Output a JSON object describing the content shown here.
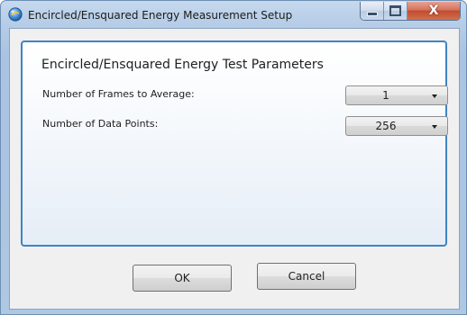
{
  "window": {
    "title": "Encircled/Ensquared Energy Measurement Setup",
    "icon": "app-globe-icon",
    "controls": {
      "minimize": "minimize-icon",
      "maximize": "maximize-icon",
      "close_glyph": "X"
    }
  },
  "parameters": {
    "group_title": "Encircled/Ensquared Energy Test Parameters",
    "frames_label": "Number of Frames to Average:",
    "frames_value": "1",
    "points_label": "Number of Data Points:",
    "points_value": "256"
  },
  "buttons": {
    "ok": "OK",
    "cancel": "Cancel"
  },
  "colors": {
    "group_border": "#3e84c4",
    "close_button": "#c24c2e",
    "frame": "#b9cfe8"
  }
}
